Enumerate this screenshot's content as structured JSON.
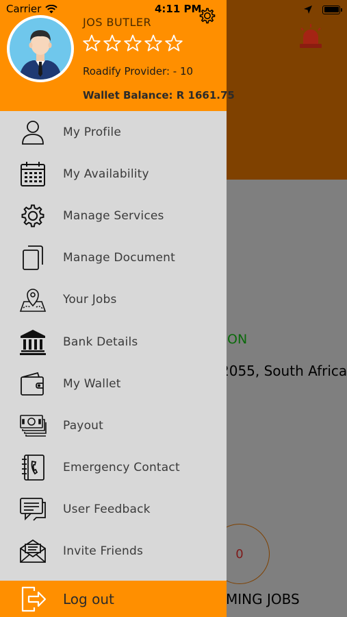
{
  "status_bar": {
    "carrier": "Carrier",
    "time": "4:11 PM"
  },
  "profile": {
    "name": "JOS BUTLER",
    "rating": 0,
    "max_rating": 5,
    "provider_text": "Roadify Provider: - 10",
    "wallet_text": "Wallet Balance: R 1661.75"
  },
  "menu": [
    {
      "label": "My Profile",
      "icon": "user-icon"
    },
    {
      "label": "My Availability",
      "icon": "calendar-icon"
    },
    {
      "label": "Manage Services",
      "icon": "gear-icon"
    },
    {
      "label": "Manage Document",
      "icon": "document-icon"
    },
    {
      "label": "Your Jobs",
      "icon": "map-pin-icon"
    },
    {
      "label": "Bank Details",
      "icon": "bank-icon"
    },
    {
      "label": "My Wallet",
      "icon": "wallet-icon"
    },
    {
      "label": "Payout",
      "icon": "cash-icon"
    },
    {
      "label": "Emergency Contact",
      "icon": "phone-book-icon"
    },
    {
      "label": "User Feedback",
      "icon": "feedback-icon"
    },
    {
      "label": "Invite Friends",
      "icon": "mail-icon"
    }
  ],
  "logout": {
    "label": "Log out"
  },
  "background": {
    "status_text": "ON",
    "address": "2055, South Africa",
    "count": "0",
    "jobs_label": "MING JOBS"
  },
  "colors": {
    "accent": "#FF8F00",
    "drawer_bg": "#D8D8D8"
  }
}
